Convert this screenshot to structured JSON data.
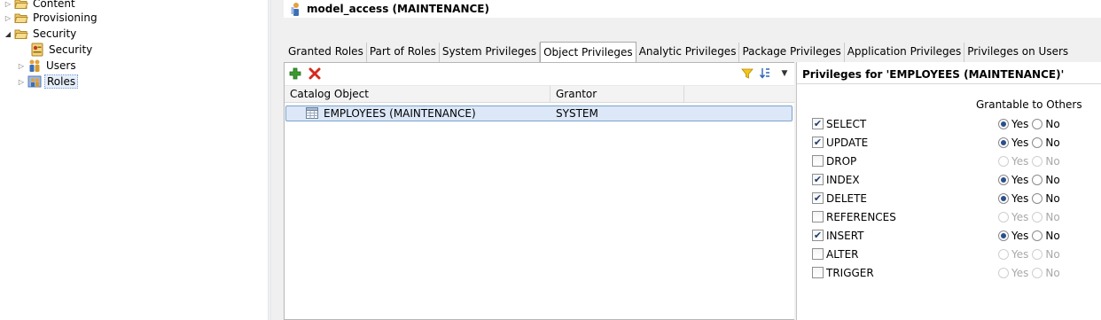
{
  "tree": {
    "items": [
      {
        "label": "Content",
        "icon": "folder-open-icon",
        "twisty": "collapsed",
        "level": 0
      },
      {
        "label": "Provisioning",
        "icon": "folder-open-icon",
        "twisty": "collapsed",
        "level": 0
      },
      {
        "label": "Security",
        "icon": "folder-open-icon",
        "twisty": "expanded",
        "level": 0
      },
      {
        "label": "Security",
        "icon": "security-console-icon",
        "twisty": "none",
        "level": 1
      },
      {
        "label": "Users",
        "icon": "users-icon",
        "twisty": "collapsed",
        "level": 1
      },
      {
        "label": "Roles",
        "icon": "roles-icon",
        "twisty": "collapsed",
        "level": 1,
        "selected": true
      }
    ]
  },
  "editor": {
    "title": "model_access (MAINTENANCE)",
    "tabs": [
      {
        "label": "Granted Roles",
        "active": false
      },
      {
        "label": "Part of Roles",
        "active": false
      },
      {
        "label": "System Privileges",
        "active": false
      },
      {
        "label": "Object Privileges",
        "active": true
      },
      {
        "label": "Analytic Privileges",
        "active": false
      },
      {
        "label": "Package Privileges",
        "active": false
      },
      {
        "label": "Application Privileges",
        "active": false
      },
      {
        "label": "Privileges on Users",
        "active": false
      }
    ]
  },
  "object_list": {
    "columns": [
      "Catalog Object",
      "Grantor"
    ],
    "rows": [
      {
        "catalog_object": "EMPLOYEES (MAINTENANCE)",
        "grantor": "SYSTEM",
        "selected": true
      }
    ]
  },
  "privileges": {
    "title": "Privileges for 'EMPLOYEES (MAINTENANCE)'",
    "grantable_header": "Grantable to Others",
    "yes_label": "Yes",
    "no_label": "No",
    "items": [
      {
        "name": "SELECT",
        "checked": true,
        "grantable": "Yes"
      },
      {
        "name": "UPDATE",
        "checked": true,
        "grantable": "Yes"
      },
      {
        "name": "DROP",
        "checked": false,
        "grantable": null
      },
      {
        "name": "INDEX",
        "checked": true,
        "grantable": "Yes"
      },
      {
        "name": "DELETE",
        "checked": true,
        "grantable": "Yes"
      },
      {
        "name": "REFERENCES",
        "checked": false,
        "grantable": null
      },
      {
        "name": "INSERT",
        "checked": true,
        "grantable": "Yes"
      },
      {
        "name": "ALTER",
        "checked": false,
        "grantable": null
      },
      {
        "name": "TRIGGER",
        "checked": false,
        "grantable": null
      }
    ]
  },
  "colors": {
    "selection_bg": "#dce8f8",
    "selection_border": "#7da2ce",
    "panel_bg": "#f0f0f0",
    "radio_dot": "#2b4f8c",
    "add_icon": "#3a9c2f",
    "delete_icon": "#d42a1f",
    "filter_icon": "#e0b000",
    "folder_icon": "#e8c766"
  }
}
